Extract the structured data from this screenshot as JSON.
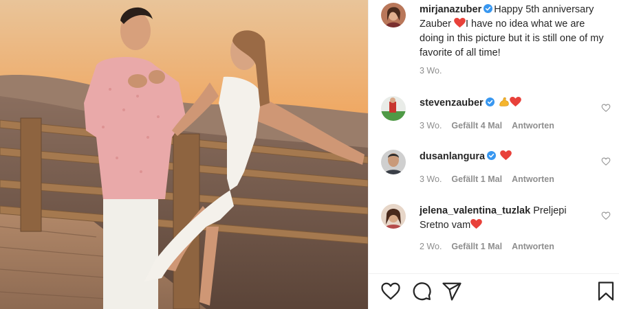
{
  "post": {
    "caption": {
      "username": "mirjanazuber",
      "text_before_emoji": "Happy 5th anniversary Zauber",
      "text_after_emoji": "I have no idea what we are doing in this picture but it is still one of my favorite of all time!",
      "time": "3 Wo."
    },
    "comments": [
      {
        "username": "stevenzauber",
        "verified": true,
        "emojis": [
          "flexed-biceps",
          "red-heart"
        ],
        "time": "3 Wo.",
        "likes": "Gefällt 4 Mal",
        "reply": "Antworten"
      },
      {
        "username": "dusanlangura",
        "verified": true,
        "emojis": [
          "red-heart"
        ],
        "time": "3 Wo.",
        "likes": "Gefällt 1 Mal",
        "reply": "Antworten"
      },
      {
        "username": "jelena_valentina_tuzlak",
        "verified": false,
        "text": "Preljepi Sretno vam",
        "emojis": [
          "red-heart"
        ],
        "time": "2 Wo.",
        "likes": "Gefällt 1 Mal",
        "reply": "Antworten"
      }
    ],
    "actions": [
      "heart-icon",
      "comment-icon",
      "share-icon",
      "bookmark-icon"
    ]
  },
  "colors": {
    "verified": "#3897f0",
    "heart_emoji": "#e8413a",
    "muted_text": "#8e8e8e"
  }
}
